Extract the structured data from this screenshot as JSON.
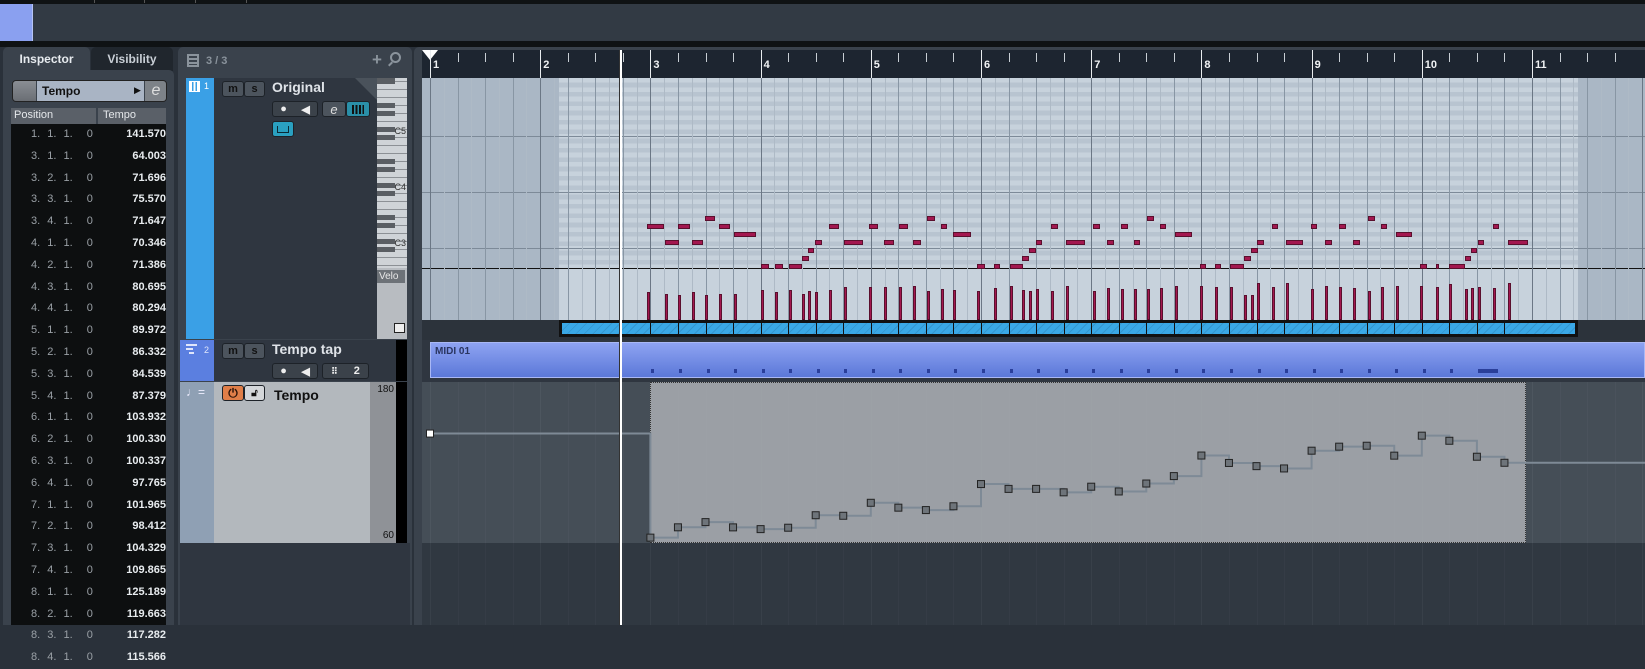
{
  "inspector": {
    "tabs": [
      "Inspector",
      "Visibility"
    ],
    "dropdown": {
      "label": "Tempo",
      "edit_label": "e"
    },
    "table": {
      "headers": [
        "Position",
        "Tempo"
      ],
      "rows": [
        {
          "position": "1. 1. 1.  0",
          "tempo": "141.570"
        },
        {
          "position": "3. 1. 1.  0",
          "tempo": "64.003"
        },
        {
          "position": "3. 2. 1.  0",
          "tempo": "71.696"
        },
        {
          "position": "3. 3. 1.  0",
          "tempo": "75.570"
        },
        {
          "position": "3. 4. 1.  0",
          "tempo": "71.647"
        },
        {
          "position": "4. 1. 1.  0",
          "tempo": "70.346"
        },
        {
          "position": "4. 2. 1.  0",
          "tempo": "71.386"
        },
        {
          "position": "4. 3. 1.  0",
          "tempo": "80.695"
        },
        {
          "position": "4. 4. 1.  0",
          "tempo": "80.294"
        },
        {
          "position": "5. 1. 1.  0",
          "tempo": "89.972"
        },
        {
          "position": "5. 2. 1.  0",
          "tempo": "86.332"
        },
        {
          "position": "5. 3. 1.  0",
          "tempo": "84.539"
        },
        {
          "position": "5. 4. 1.  0",
          "tempo": "87.379"
        },
        {
          "position": "6. 1. 1.  0",
          "tempo": "103.932"
        },
        {
          "position": "6. 2. 1.  0",
          "tempo": "100.330"
        },
        {
          "position": "6. 3. 1.  0",
          "tempo": "100.337"
        },
        {
          "position": "6. 4. 1.  0",
          "tempo": "97.765"
        },
        {
          "position": "7. 1. 1.  0",
          "tempo": "101.965"
        },
        {
          "position": "7. 2. 1.  0",
          "tempo": "98.412"
        },
        {
          "position": "7. 3. 1.  0",
          "tempo": "104.329"
        },
        {
          "position": "7. 4. 1.  0",
          "tempo": "109.865"
        },
        {
          "position": "8. 1. 1.  0",
          "tempo": "125.189"
        },
        {
          "position": "8. 2. 1.  0",
          "tempo": "119.663"
        },
        {
          "position": "8. 3. 1.  0",
          "tempo": "117.282"
        },
        {
          "position": "8. 4. 1.  0",
          "tempo": "115.566"
        }
      ]
    }
  },
  "tracklist": {
    "count": "3 / 3",
    "tracks": [
      {
        "number": "1",
        "name": "Original",
        "mute": "m",
        "solo": "s",
        "edit": "e"
      },
      {
        "number": "2",
        "name": "Tempo tap",
        "mute": "m",
        "solo": "s",
        "value": "2"
      },
      {
        "name": "Tempo",
        "range_max": "180",
        "range_min": "60"
      }
    ],
    "piano_labels": [
      "C5",
      "C4",
      "C3"
    ],
    "velo_label": "Velo"
  },
  "ruler": {
    "bars": [
      "1",
      "2",
      "3",
      "4",
      "5",
      "6",
      "7",
      "8",
      "9",
      "10",
      "11"
    ]
  },
  "midi_part": {
    "name": "MIDI 01"
  },
  "colors": {
    "note": "#a3174f",
    "track1": "#3aa0e6",
    "track2": "#5b7fe0",
    "power": "#e07e48",
    "region": "#3aa8e6"
  },
  "notes_format": "start beat (0 = bar 1), length in beats, pitch step below top row, velocity",
  "notes": [
    [
      7.88,
      0.62,
      1,
      68
    ],
    [
      8.53,
      0.5,
      3,
      64
    ],
    [
      9.0,
      0.44,
      1,
      62
    ],
    [
      9.51,
      0.4,
      3,
      68
    ],
    [
      9.98,
      0.36,
      0,
      62
    ],
    [
      10.49,
      0.4,
      1,
      64
    ],
    [
      11.03,
      0.8,
      2,
      64
    ],
    [
      12.01,
      0.3,
      6,
      74
    ],
    [
      12.52,
      0.3,
      6,
      68
    ],
    [
      13.03,
      0.47,
      6,
      74
    ],
    [
      13.5,
      0.25,
      5,
      64
    ],
    [
      13.72,
      0.22,
      4,
      70
    ],
    [
      13.97,
      0.25,
      3,
      68
    ],
    [
      14.48,
      0.36,
      1,
      74
    ],
    [
      15.03,
      0.7,
      3,
      80
    ],
    [
      15.93,
      0.33,
      1,
      80
    ],
    [
      16.48,
      0.36,
      3,
      80
    ],
    [
      17.02,
      0.33,
      1,
      80
    ],
    [
      17.53,
      0.3,
      3,
      82
    ],
    [
      18.04,
      0.3,
      0,
      72
    ],
    [
      18.55,
      0.22,
      1,
      76
    ],
    [
      18.98,
      0.65,
      2,
      74
    ],
    [
      19.85,
      0.3,
      6,
      72
    ],
    [
      20.47,
      0.22,
      6,
      78
    ],
    [
      21.05,
      0.47,
      6,
      82
    ],
    [
      21.49,
      0.25,
      5,
      74
    ],
    [
      21.74,
      0.25,
      4,
      72
    ],
    [
      22.0,
      0.22,
      3,
      76
    ],
    [
      22.54,
      0.25,
      1,
      72
    ],
    [
      23.09,
      0.7,
      3,
      82
    ],
    [
      24.07,
      0.25,
      1,
      72
    ],
    [
      24.57,
      0.25,
      3,
      78
    ],
    [
      25.08,
      0.25,
      1,
      76
    ],
    [
      25.55,
      0.22,
      3,
      76
    ],
    [
      26.03,
      0.25,
      0,
      76
    ],
    [
      26.5,
      0.22,
      1,
      78
    ],
    [
      27.04,
      0.62,
      2,
      84
    ],
    [
      27.95,
      0.22,
      6,
      84
    ],
    [
      28.49,
      0.22,
      6,
      80
    ],
    [
      29.04,
      0.5,
      6,
      80
    ],
    [
      29.55,
      0.25,
      5,
      62
    ],
    [
      29.8,
      0.25,
      4,
      60
    ],
    [
      30.02,
      0.25,
      3,
      90
    ],
    [
      30.56,
      0.22,
      1,
      80
    ],
    [
      31.07,
      0.62,
      3,
      90
    ],
    [
      31.98,
      0.22,
      1,
      76
    ],
    [
      32.49,
      0.25,
      3,
      82
    ],
    [
      32.99,
      0.25,
      1,
      80
    ],
    [
      33.5,
      0.25,
      3,
      78
    ],
    [
      34.05,
      0.25,
      0,
      70
    ],
    [
      34.52,
      0.2,
      1,
      80
    ],
    [
      35.06,
      0.58,
      2,
      82
    ],
    [
      35.93,
      0.25,
      6,
      84
    ],
    [
      36.52,
      0.12,
      6,
      80
    ],
    [
      36.99,
      0.58,
      6,
      88
    ],
    [
      37.57,
      0.22,
      5,
      76
    ],
    [
      37.79,
      0.22,
      4,
      78
    ],
    [
      38.04,
      0.2,
      3,
      80
    ],
    [
      38.58,
      0.22,
      1,
      78
    ],
    [
      39.13,
      0.73,
      3,
      90
    ]
  ],
  "tempo_lane": {
    "range": [
      60,
      180
    ],
    "extra_points": [
      {
        "bar": 9,
        "beat": 1,
        "tempo": 128.8
      },
      {
        "bar": 9,
        "beat": 2,
        "tempo": 131.8
      },
      {
        "bar": 9,
        "beat": 3,
        "tempo": 132.5
      },
      {
        "bar": 9,
        "beat": 4,
        "tempo": 125.1
      },
      {
        "bar": 10,
        "beat": 1,
        "tempo": 140.0
      },
      {
        "bar": 10,
        "beat": 2,
        "tempo": 136.2
      },
      {
        "bar": 10,
        "beat": 3,
        "tempo": 124.3
      },
      {
        "bar": 10,
        "beat": 4,
        "tempo": 119.8
      }
    ],
    "selection_beats": [
      8,
      39.8
    ]
  },
  "playhead_beat": 6.85
}
